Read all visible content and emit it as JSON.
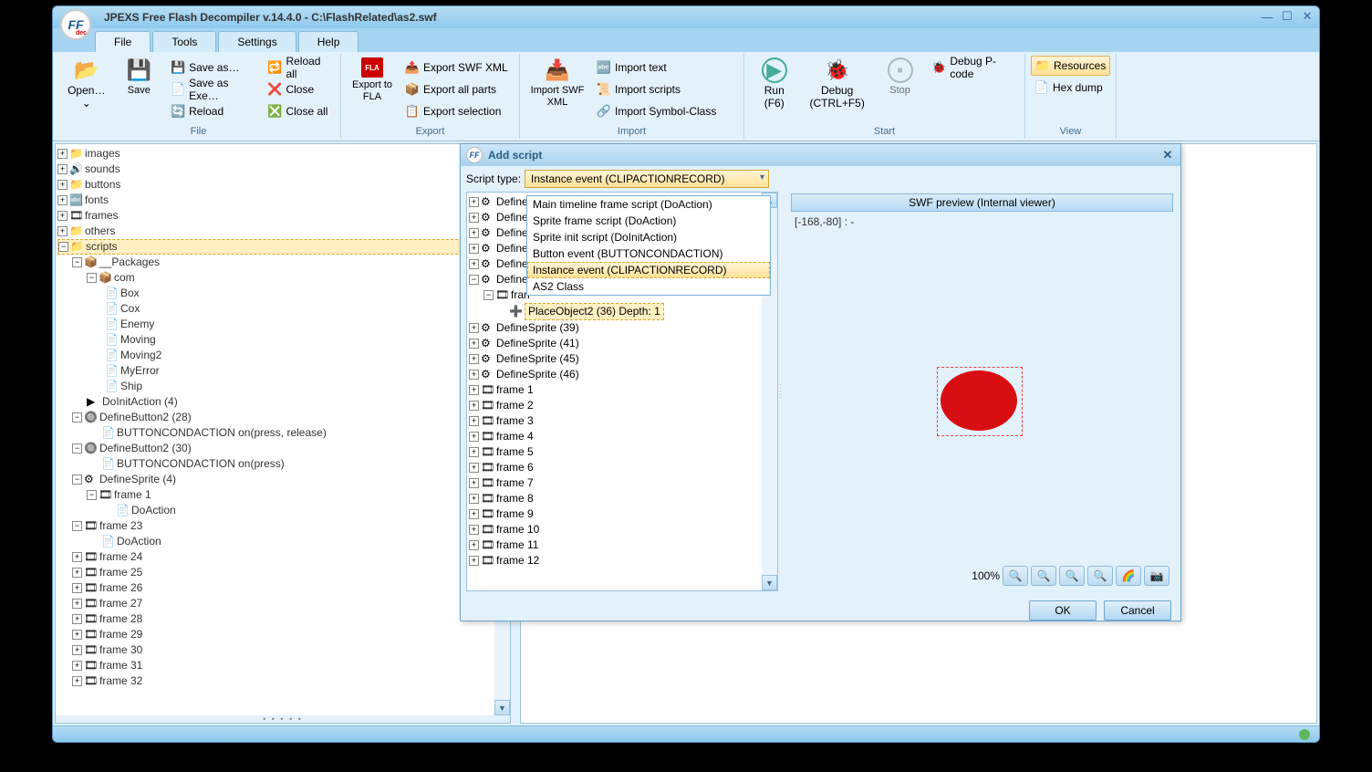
{
  "window": {
    "title": "JPEXS Free Flash Decompiler v.14.4.0 - C:\\FlashRelated\\as2.swf"
  },
  "menubar": [
    "File",
    "Tools",
    "Settings",
    "Help"
  ],
  "ribbon": {
    "file": {
      "label": "File",
      "open": "Open…",
      "open_arrow": "⌄",
      "save": "Save",
      "saveas": "Save as…",
      "saveexe": "Save as Exe…",
      "reload": "Reload",
      "reloadall": "Reload all",
      "close": "Close",
      "closeall": "Close all"
    },
    "export": {
      "label": "Export",
      "tofla": "Export to FLA",
      "swfxml": "Export SWF XML",
      "allparts": "Export all parts",
      "selection": "Export selection"
    },
    "import": {
      "label": "Import",
      "swfxml": "Import SWF XML",
      "text": "Import text",
      "scripts": "Import scripts",
      "symbol": "Import Symbol-Class"
    },
    "start": {
      "label": "Start",
      "run": "Run",
      "run_sub": "(F6)",
      "debug": "Debug",
      "debug_sub": "(CTRL+F5)",
      "stop": "Stop",
      "debugpcode": "Debug P-code"
    },
    "view": {
      "label": "View",
      "resources": "Resources",
      "hexdump": "Hex dump"
    }
  },
  "tree": {
    "top": [
      "images",
      "sounds",
      "buttons",
      "fonts",
      "frames",
      "others",
      "scripts"
    ],
    "packages": "__Packages",
    "com": "com",
    "classes": [
      "Box",
      "Cox",
      "Enemy",
      "Moving",
      "Moving2",
      "MyError",
      "Ship"
    ],
    "doinit": "DoInitAction (4)",
    "defbtn28": "DefineButton2 (28)",
    "btnact1": "BUTTONCONDACTION on(press, release)",
    "defbtn30": "DefineButton2 (30)",
    "btnact2": "BUTTONCONDACTION on(press)",
    "defsprite4": "DefineSprite (4)",
    "frame1": "frame 1",
    "doaction": "DoAction",
    "frame23": "frame 23",
    "frames_tail": [
      "frame 24",
      "frame 25",
      "frame 26",
      "frame 27",
      "frame 28",
      "frame 29",
      "frame 30",
      "frame 31",
      "frame 32"
    ]
  },
  "dialog": {
    "title": "Add script",
    "script_type_label": "Script type:",
    "combo_value": "Instance event (CLIPACTIONRECORD)",
    "options": [
      "Main timeline frame script (DoAction)",
      "Sprite frame script (DoAction)",
      "Sprite init script (DoInitAction)",
      "Button event (BUTTONCONDACTION)",
      "Instance event (CLIPACTIONRECORD)",
      "AS2 Class"
    ],
    "tree_defines": [
      "Define",
      "Define",
      "Define",
      "Define",
      "Define",
      "Define"
    ],
    "tree_frame": "fran",
    "placeobj": "PlaceObject2 (36) Depth: 1",
    "sprites": [
      "DefineSprite (39)",
      "DefineSprite (41)",
      "DefineSprite (45)",
      "DefineSprite (46)"
    ],
    "frames": [
      "frame 1",
      "frame 2",
      "frame 3",
      "frame 4",
      "frame 5",
      "frame 6",
      "frame 7",
      "frame 8",
      "frame 9",
      "frame 10",
      "frame 11",
      "frame 12"
    ],
    "ok": "OK",
    "cancel": "Cancel"
  },
  "preview": {
    "header": "SWF preview (Internal viewer)",
    "coord": "[-168,-80] :  -",
    "zoom": "100%"
  }
}
